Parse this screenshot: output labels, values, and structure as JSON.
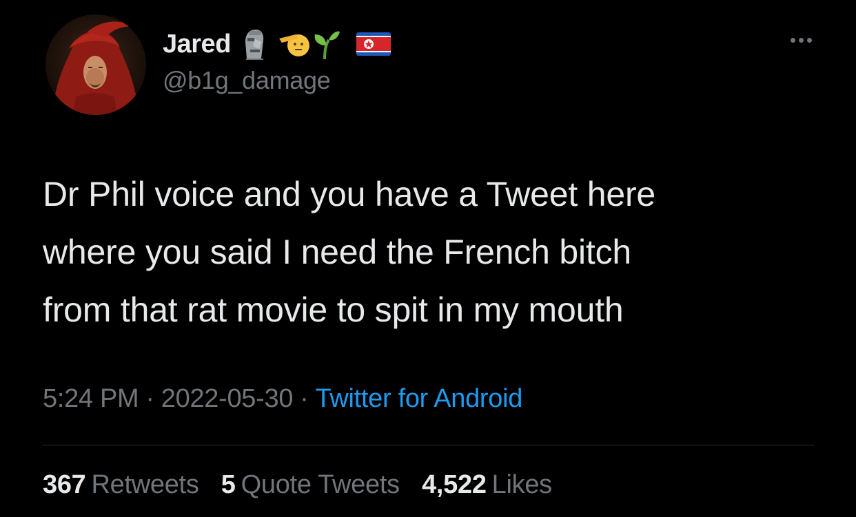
{
  "author": {
    "display_name": "Jared",
    "handle": "@b1g_damage",
    "name_emoji": [
      "moai-icon",
      "saluting-face-icon",
      "seedling-icon",
      "north-korea-flag-icon"
    ]
  },
  "tweet": {
    "text_lines": [
      "Dr Phil voice and you have a Tweet here",
      "where you said I need the French bitch",
      "from that rat movie to spit in my mouth"
    ],
    "time": "5:24 PM",
    "date": "2022-05-30",
    "separator": "·",
    "source": "Twitter for Android"
  },
  "stats": {
    "retweets_count": "367",
    "retweets_label": "Retweets",
    "quotes_count": "5",
    "quotes_label": "Quote Tweets",
    "likes_count": "4,522",
    "likes_label": "Likes"
  },
  "colors": {
    "background": "#000000",
    "text": "#e7e9ea",
    "muted": "#71767b",
    "link": "#1d9bf0",
    "divider": "#2f3336"
  },
  "icons": {
    "more": "more-horizontal-icon"
  }
}
